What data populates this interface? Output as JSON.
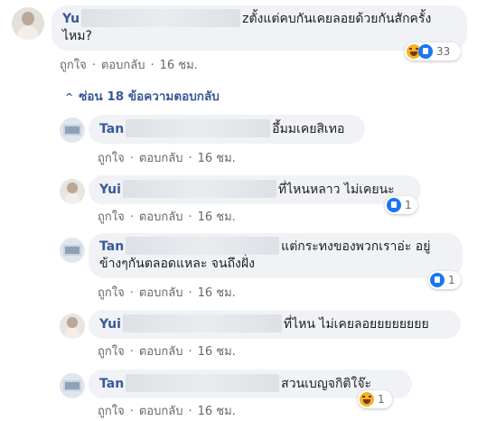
{
  "main_comment": {
    "name": "Yu",
    "text_line1": "zตั้งแต่คบกันเคยลอยด้วยกันสักครั้ง",
    "text_line2": "ไหม?",
    "actions": {
      "like": "ถูกใจ",
      "reply": "ตอบกลับ",
      "time": "16 ชม."
    },
    "reactions": {
      "icons": [
        "haha-icon",
        "like-icon"
      ],
      "count": "33"
    }
  },
  "hide_replies": {
    "chevron": "^",
    "label": "ซ่อน 18 ข้อความตอบกลับ"
  },
  "replies": [
    {
      "name": "Tan",
      "text": "อึ้มมเคยสิเทอ",
      "actions": {
        "like": "ถูกใจ",
        "reply": "ตอบกลับ",
        "time": "16 ชม."
      }
    },
    {
      "name": "Yui",
      "text": "ที่ไหนหลาว ไม่เคยนะ",
      "actions": {
        "like": "ถูกใจ",
        "reply": "ตอบกลับ",
        "time": "16 ชม."
      },
      "reactions": {
        "icons": [
          "like-icon"
        ],
        "count": "1"
      }
    },
    {
      "name": "Tan",
      "text_line1": "แต่กระทงของพวกเราอ่ะ อยู่",
      "text_line2": "ข้างๆกันตลอดแหละ จนถึงฝั่ง",
      "actions": {
        "like": "ถูกใจ",
        "reply": "ตอบกลับ",
        "time": "16 ชม."
      },
      "reactions": {
        "icons": [
          "like-icon"
        ],
        "count": "1"
      }
    },
    {
      "name": "Yui",
      "text": "ที่ไหน ไม่เคยลอยยยยยยยย",
      "actions": {
        "like": "ถูกใจ",
        "reply": "ตอบกลับ",
        "time": "16 ชม."
      }
    },
    {
      "name": "Tan",
      "text": "สวนเบญจกิติใจ๊ะ",
      "actions": {
        "like": "ถูกใจ",
        "reply": "ตอบกลับ",
        "time": "16 ชม."
      },
      "reactions": {
        "icons": [
          "haha-icon"
        ],
        "count": "1"
      }
    }
  ],
  "colors": {
    "name": "#385898",
    "bubble": "#f0f2f5",
    "meta": "#65676b",
    "like": "#1877f2",
    "haha": "#f7b125"
  }
}
